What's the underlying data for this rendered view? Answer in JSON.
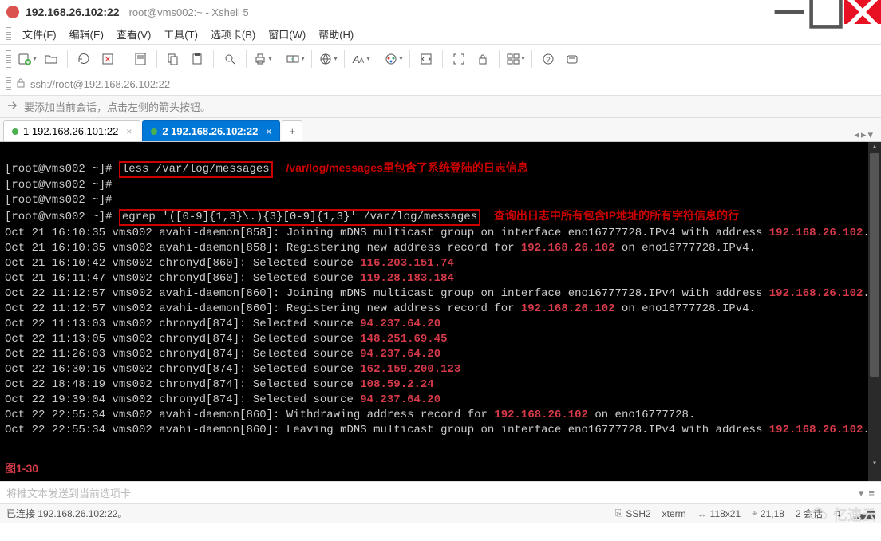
{
  "window": {
    "title_main": "192.168.26.102:22",
    "title_sub": "root@vms002:~ - Xshell 5"
  },
  "menu": {
    "file": "文件(F)",
    "edit": "编辑(E)",
    "view": "查看(V)",
    "tools": "工具(T)",
    "tabs": "选项卡(B)",
    "window": "窗口(W)",
    "help": "帮助(H)"
  },
  "address": {
    "url": "ssh://root@192.168.26.102:22"
  },
  "hint": {
    "text": "要添加当前会话，点击左侧的箭头按钮。"
  },
  "tabsbar": {
    "tab1": {
      "index": "1",
      "label": "192.168.26.101:22"
    },
    "tab2": {
      "index": "2",
      "label": "192.168.26.102:22"
    }
  },
  "terminal": {
    "prompt": "[root@vms002 ~]#",
    "cmd1": "less /var/log/messages",
    "ann1": "/var/log/messages里包含了系统登陆的日志信息",
    "cmd2": "egrep '([0-9]{1,3}\\.){3}[0-9]{1,3}' /var/log/messages",
    "ann2": "查询出日志中所有包含IP地址的所有字符信息的行",
    "lines": [
      {
        "pre": "Oct 21 16:10:35 vms002 avahi-daemon[858]: Joining mDNS multicast group on interface eno16777728.IPv4 with address ",
        "ip": "192.168.26.102",
        "post": "."
      },
      {
        "pre": "Oct 21 16:10:35 vms002 avahi-daemon[858]: Registering new address record for ",
        "ip": "192.168.26.102",
        "post": " on eno16777728.IPv4."
      },
      {
        "pre": "Oct 21 16:10:42 vms002 chronyd[860]: Selected source ",
        "ip": "116.203.151.74",
        "post": ""
      },
      {
        "pre": "Oct 21 16:11:47 vms002 chronyd[860]: Selected source ",
        "ip": "119.28.183.184",
        "post": ""
      },
      {
        "pre": "Oct 22 11:12:57 vms002 avahi-daemon[860]: Joining mDNS multicast group on interface eno16777728.IPv4 with address ",
        "ip": "192.168.26.102",
        "post": "."
      },
      {
        "pre": "Oct 22 11:12:57 vms002 avahi-daemon[860]: Registering new address record for ",
        "ip": "192.168.26.102",
        "post": " on eno16777728.IPv4."
      },
      {
        "pre": "Oct 22 11:13:03 vms002 chronyd[874]: Selected source ",
        "ip": "94.237.64.20",
        "post": ""
      },
      {
        "pre": "Oct 22 11:13:05 vms002 chronyd[874]: Selected source ",
        "ip": "148.251.69.45",
        "post": ""
      },
      {
        "pre": "Oct 22 11:26:03 vms002 chronyd[874]: Selected source ",
        "ip": "94.237.64.20",
        "post": ""
      },
      {
        "pre": "Oct 22 16:30:16 vms002 chronyd[874]: Selected source ",
        "ip": "162.159.200.123",
        "post": ""
      },
      {
        "pre": "Oct 22 18:48:19 vms002 chronyd[874]: Selected source ",
        "ip": "108.59.2.24",
        "post": ""
      },
      {
        "pre": "Oct 22 19:39:04 vms002 chronyd[874]: Selected source ",
        "ip": "94.237.64.20",
        "post": ""
      },
      {
        "pre": "Oct 22 22:55:34 vms002 avahi-daemon[860]: Withdrawing address record for ",
        "ip": "192.168.26.102",
        "post": " on eno16777728."
      },
      {
        "pre": "Oct 22 22:55:34 vms002 avahi-daemon[860]: Leaving mDNS multicast group on interface eno16777728.IPv4 with address ",
        "ip": "192.168.26.102",
        "post": "."
      }
    ],
    "fig": "图1-30"
  },
  "footer": {
    "ghost": "将推文本发送到当前选项卡"
  },
  "status": {
    "connected": "已连接 192.168.26.102:22。",
    "ssh": "SSH2",
    "term": "xterm",
    "size": "118x21",
    "pos": "21,18",
    "sessions": "2 会话"
  },
  "watermark": "亿速云"
}
